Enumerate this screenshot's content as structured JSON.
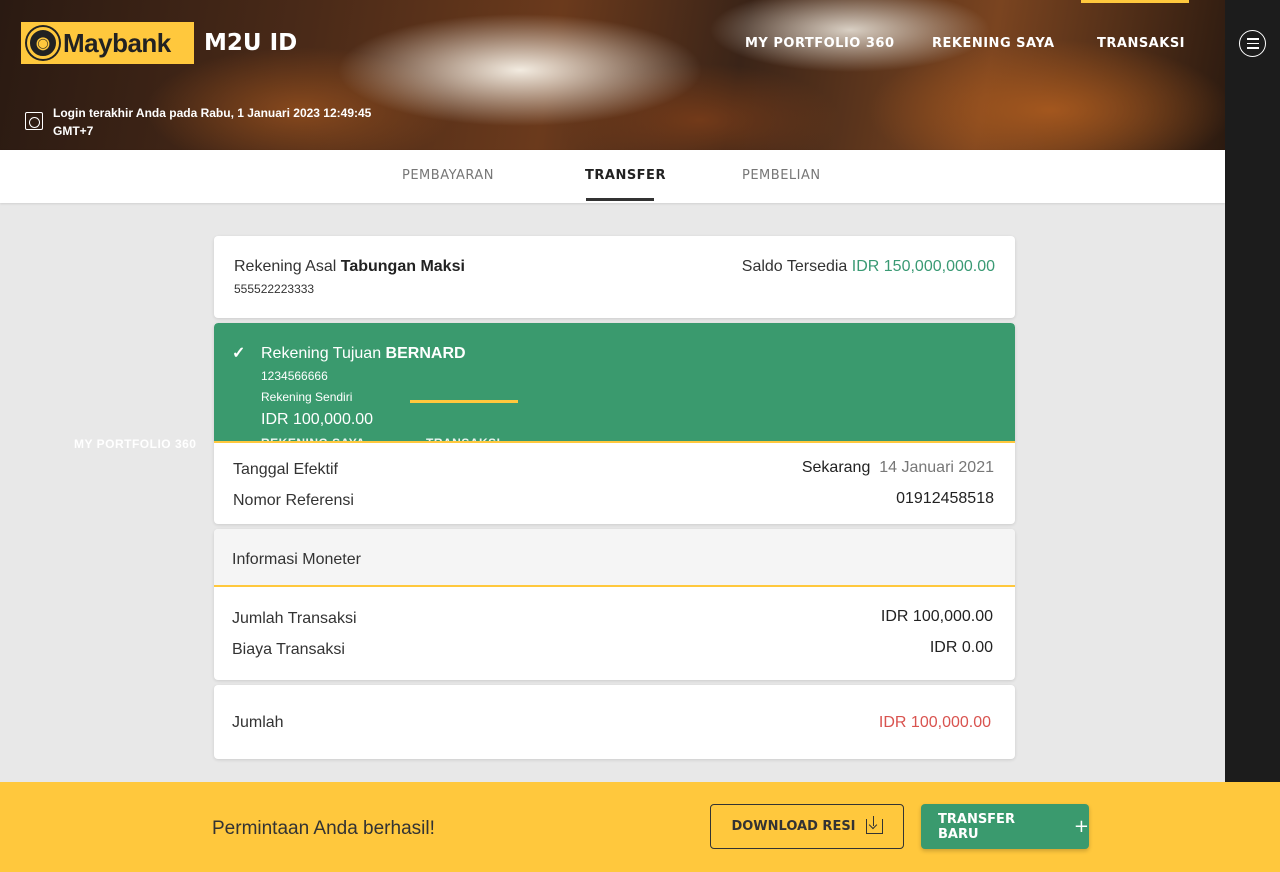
{
  "header": {
    "brand": "Maybank",
    "app_title": "M2U ID",
    "nav": [
      "MY PORTFOLIO 360",
      "REKENING SAYA",
      "TRANSAKSI"
    ],
    "login_line1": "Login terakhir Anda pada Rabu, 1 Januari 2023 12:49:45",
    "login_line2": "GMT+7"
  },
  "subnav": {
    "tabs": [
      "PEMBAYARAN",
      "TRANSFER",
      "PEMBELIAN"
    ],
    "active": "TRANSFER"
  },
  "source": {
    "label": "Rekening Asal",
    "name": "Tabungan Maksi",
    "number": "555522223333",
    "balance_label": "Saldo Tersedia",
    "balance": "IDR 150,000,000.00"
  },
  "destination": {
    "label": "Rekening Tujuan",
    "name": "BERNARD",
    "number": "1234566666",
    "type": "Rekening Sendiri",
    "amount": "IDR 100,000.00",
    "ghost_nav": [
      "MY PORTFOLIO 360",
      "REKENING SAYA",
      "TRANSAKSI"
    ]
  },
  "details": {
    "effective_label": "Tanggal Efektif",
    "effective_when": "Sekarang",
    "effective_date": "14 Januari 2021",
    "ref_label": "Nomor Referensi",
    "ref_value": "01912458518"
  },
  "monetary": {
    "title": "Informasi Moneter",
    "amount_label": "Jumlah Transaksi",
    "amount_value": "IDR 100,000.00",
    "fee_label": "Biaya Transaksi",
    "fee_value": "IDR 0.00"
  },
  "total": {
    "label": "Jumlah",
    "value": "IDR 100,000.00"
  },
  "footer": {
    "message": "Permintaan Anda berhasil!",
    "download_label": "DOWNLOAD RESI",
    "new_label": "TRANSFER BARU"
  },
  "colors": {
    "brand_yellow": "#ffc83d",
    "success_green": "#3a9a6e",
    "total_red": "#d9534f"
  }
}
